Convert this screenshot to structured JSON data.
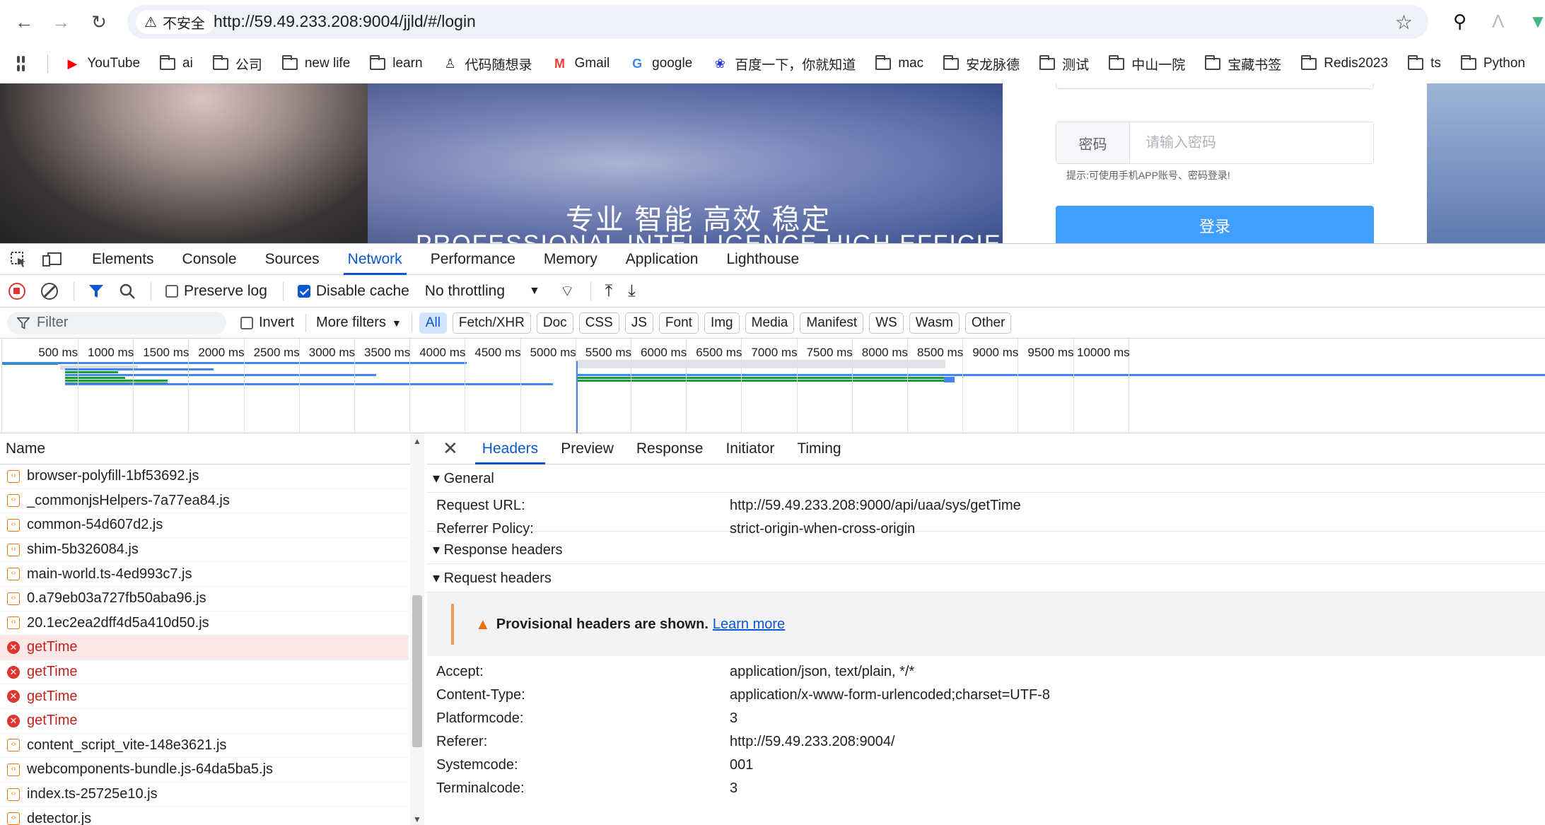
{
  "browser": {
    "security_label": "不安全",
    "url": "http://59.49.233.208:9004/jjld/#/login",
    "bookmarks": [
      {
        "label": "YouTube",
        "icon": "youtube-icon"
      },
      {
        "label": "ai",
        "icon": "folder-icon"
      },
      {
        "label": "公司",
        "icon": "folder-icon"
      },
      {
        "label": "new life",
        "icon": "folder-icon"
      },
      {
        "label": "learn",
        "icon": "folder-icon"
      },
      {
        "label": "代码随想录",
        "icon": "site-icon"
      },
      {
        "label": "Gmail",
        "icon": "gmail-icon"
      },
      {
        "label": "google",
        "icon": "google-icon"
      },
      {
        "label": "百度一下，你就知道",
        "icon": "baidu-icon"
      },
      {
        "label": "mac",
        "icon": "folder-icon"
      },
      {
        "label": "安龙脉德",
        "icon": "folder-icon"
      },
      {
        "label": "测试",
        "icon": "folder-icon"
      },
      {
        "label": "中山一院",
        "icon": "folder-icon"
      },
      {
        "label": "宝藏书签",
        "icon": "folder-icon"
      },
      {
        "label": "Redis2023",
        "icon": "folder-icon"
      },
      {
        "label": "ts",
        "icon": "folder-icon"
      },
      {
        "label": "Python",
        "icon": "folder-icon"
      }
    ]
  },
  "page": {
    "slogan_cn": "专业 智能 高效 稳定",
    "slogan_en": "PROFESSIONAL    INTELLIGENCE    HIGH    EFFICIENCY",
    "password_label": "密码",
    "password_placeholder": "请输入密码",
    "hint": "提示:可使用手机APP账号、密码登录!",
    "login_button": "登录"
  },
  "devtools": {
    "tabs": [
      "Elements",
      "Console",
      "Sources",
      "Network",
      "Performance",
      "Memory",
      "Application",
      "Lighthouse"
    ],
    "active_tab": "Network",
    "toolbar": {
      "preserve_log": "Preserve log",
      "disable_cache": "Disable cache",
      "throttling": "No throttling"
    },
    "filterbar": {
      "filter_placeholder": "Filter",
      "invert": "Invert",
      "more_filters": "More filters",
      "chips": [
        "All",
        "Fetch/XHR",
        "Doc",
        "CSS",
        "JS",
        "Font",
        "Img",
        "Media",
        "Manifest",
        "WS",
        "Wasm",
        "Other"
      ]
    },
    "timeline_labels": [
      "500 ms",
      "1000 ms",
      "1500 ms",
      "2000 ms",
      "2500 ms",
      "3000 ms",
      "3500 ms",
      "4000 ms",
      "4500 ms",
      "5000 ms",
      "5500 ms",
      "6000 ms",
      "6500 ms",
      "7000 ms",
      "7500 ms",
      "8000 ms",
      "8500 ms",
      "9000 ms",
      "9500 ms",
      "10000 ms"
    ],
    "requests": {
      "column_name": "Name",
      "rows": [
        {
          "name": "browser-polyfill-1bf53692.js",
          "status": "ok"
        },
        {
          "name": "_commonjsHelpers-7a77ea84.js",
          "status": "ok"
        },
        {
          "name": "common-54d607d2.js",
          "status": "ok"
        },
        {
          "name": "shim-5b326084.js",
          "status": "ok"
        },
        {
          "name": "main-world.ts-4ed993c7.js",
          "status": "ok"
        },
        {
          "name": "0.a79eb03a727fb50aba96.js",
          "status": "ok"
        },
        {
          "name": "20.1ec2ea2dff4d5a410d50.js",
          "status": "ok"
        },
        {
          "name": "getTime",
          "status": "error",
          "selected": true
        },
        {
          "name": "getTime",
          "status": "error"
        },
        {
          "name": "getTime",
          "status": "error"
        },
        {
          "name": "getTime",
          "status": "error"
        },
        {
          "name": "content_script_vite-148e3621.js",
          "status": "ok"
        },
        {
          "name": "webcomponents-bundle.js-64da5ba5.js",
          "status": "ok"
        },
        {
          "name": "index.ts-25725e10.js",
          "status": "ok"
        },
        {
          "name": "detector.js",
          "status": "ok"
        }
      ]
    },
    "details": {
      "tabs": [
        "Headers",
        "Preview",
        "Response",
        "Initiator",
        "Timing"
      ],
      "active_tab": "Headers",
      "general_title": "General",
      "general": [
        {
          "key": "Request URL:",
          "value": "http://59.49.233.208:9000/api/uaa/sys/getTime"
        },
        {
          "key": "Referrer Policy:",
          "value": "strict-origin-when-cross-origin"
        }
      ],
      "response_headers_title": "Response headers",
      "request_headers_title": "Request headers",
      "provisional_warning": "Provisional headers are shown.",
      "learn_more": "Learn more",
      "request_headers": [
        {
          "key": "Accept:",
          "value": "application/json, text/plain, */*"
        },
        {
          "key": "Content-Type:",
          "value": "application/x-www-form-urlencoded;charset=UTF-8"
        },
        {
          "key": "Platformcode:",
          "value": "3"
        },
        {
          "key": "Referer:",
          "value": "http://59.49.233.208:9004/"
        },
        {
          "key": "Systemcode:",
          "value": "001"
        },
        {
          "key": "Terminalcode:",
          "value": "3"
        }
      ]
    }
  },
  "colors": {
    "accent": "#0b57d0",
    "error": "#c5221f",
    "login_button": "#409eff",
    "warning": "#e8a04a"
  }
}
